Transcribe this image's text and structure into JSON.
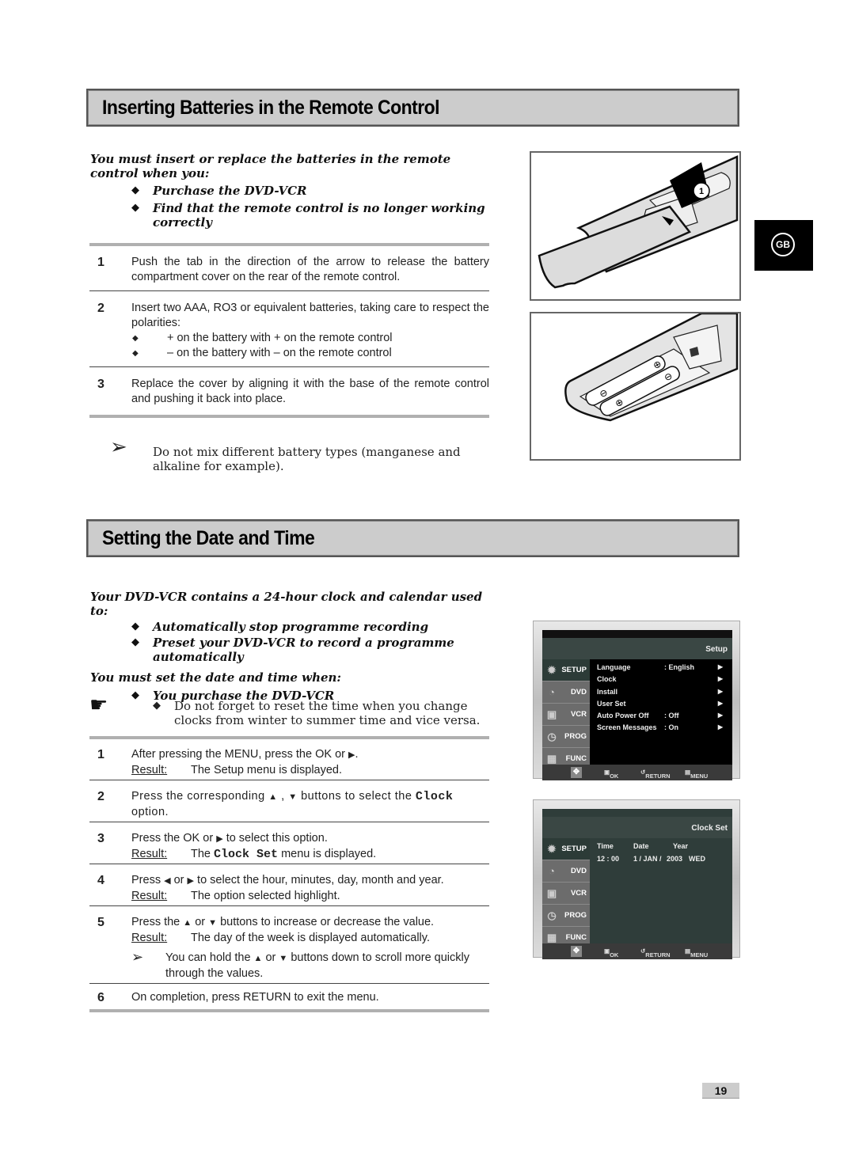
{
  "section1": {
    "title": "Inserting Batteries in the Remote Control",
    "intro": "You must insert or replace the batteries in the remote control when you:",
    "bullets": [
      "Purchase the DVD-VCR",
      "Find that the remote control is no longer working correctly"
    ],
    "steps": [
      {
        "num": "1",
        "text": "Push the tab in the direction of the arrow to release the battery compartment cover on the rear of the remote control."
      },
      {
        "num": "2",
        "text": "Insert two AAA, RO3 or equivalent batteries, taking care to respect the polarities:",
        "subs": [
          "+ on the battery with + on the remote control",
          "– on the battery with – on the remote control"
        ]
      },
      {
        "num": "3",
        "text": "Replace the cover by aligning it with the base of the remote control and pushing it back into place."
      }
    ],
    "note": "Do not mix different battery types (manganese and alkaline for example).",
    "figure_label": "1"
  },
  "language_tab": "GB",
  "section2": {
    "title": "Setting the Date and Time",
    "intro": "Your DVD-VCR contains a 24-hour clock and calendar used to:",
    "bullets": [
      "Automatically stop programme recording",
      "Preset your DVD-VCR to record a programme automatically"
    ],
    "intro2": "You must set the date and time when:",
    "bullets2": [
      "You purchase the DVD-VCR"
    ],
    "tip": "Do not forget to reset the time when you change clocks from winter to summer time and vice versa.",
    "result_label": "Result:",
    "steps": [
      {
        "num": "1",
        "text_a": "After pressing the MENU, press the OK or",
        "text_b": ".",
        "result": "The Setup menu is displayed."
      },
      {
        "num": "2",
        "text_a": "Press the corresponding",
        "text_b": "buttons to select the",
        "mono": "Clock",
        "text_c": "option."
      },
      {
        "num": "3",
        "text_a": "Press the OK or",
        "text_b": "to select this option.",
        "result_a": "The",
        "result_mono": "Clock Set",
        "result_b": "menu is displayed."
      },
      {
        "num": "4",
        "text_a": "Press",
        "text_b": "or",
        "text_c": "to select the hour, minutes, day, month and year.",
        "result": "The option selected highlight."
      },
      {
        "num": "5",
        "text_a": "Press the",
        "text_b": "or",
        "text_c": "buttons to increase or decrease the value.",
        "result": "The day of the week is displayed automatically.",
        "note_a": "You can hold the",
        "note_b": "or",
        "note_c": "buttons down to scroll more quickly through the values."
      },
      {
        "num": "6",
        "text_a": "On completion, press RETURN to exit the menu."
      }
    ]
  },
  "osd_setup": {
    "title": "Setup",
    "sidebar": [
      "SETUP",
      "DVD",
      "VCR",
      "PROG",
      "FUNC"
    ],
    "rows": [
      {
        "label": "Language",
        "value": ": English"
      },
      {
        "label": "Clock",
        "value": ""
      },
      {
        "label": "Install",
        "value": ""
      },
      {
        "label": "User Set",
        "value": ""
      },
      {
        "label": "Auto Power Off",
        "value": ": Off"
      },
      {
        "label": "Screen Messages",
        "value": ": On"
      }
    ],
    "footer": {
      "ok": "OK",
      "return": "RETURN",
      "menu": "MENU"
    }
  },
  "osd_clock": {
    "title": "Clock Set",
    "sidebar": [
      "SETUP",
      "DVD",
      "VCR",
      "PROG",
      "FUNC"
    ],
    "headers": {
      "time": "Time",
      "date": "Date",
      "year": "Year"
    },
    "values": {
      "time": "12 : 00",
      "date": "1 / JAN /",
      "year": "2003",
      "weekday": "WED"
    },
    "footer": {
      "ok": "OK",
      "return": "RETURN",
      "menu": "MENU"
    }
  },
  "page_number": "19"
}
